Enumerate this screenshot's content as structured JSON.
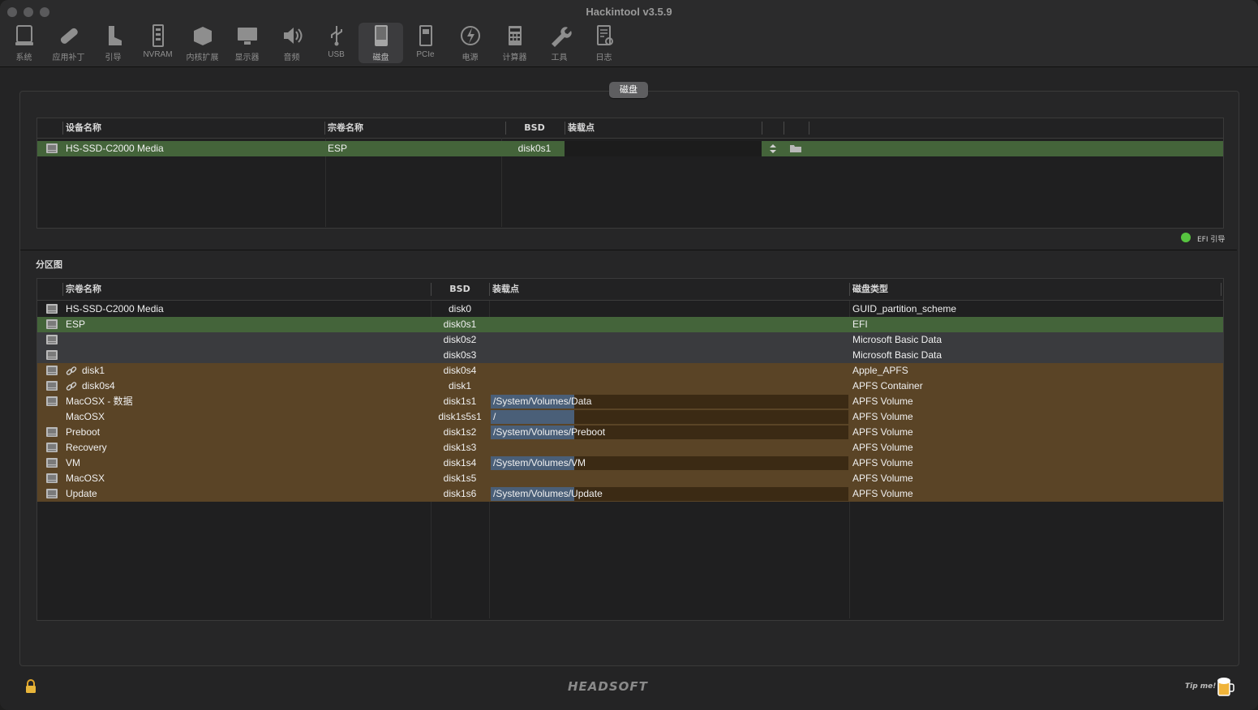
{
  "window": {
    "title": "Hackintool v3.5.9"
  },
  "toolbar": [
    {
      "label": "系统",
      "icon": "computer-icon"
    },
    {
      "label": "应用补丁",
      "icon": "bandage-icon"
    },
    {
      "label": "引导",
      "icon": "boot-icon"
    },
    {
      "label": "NVRAM",
      "icon": "nvram-icon"
    },
    {
      "label": "内核扩展",
      "icon": "kext-icon"
    },
    {
      "label": "显示器",
      "icon": "display-icon"
    },
    {
      "label": "音频",
      "icon": "speaker-icon"
    },
    {
      "label": "USB",
      "icon": "usb-icon"
    },
    {
      "label": "磁盘",
      "icon": "disk-icon",
      "active": true
    },
    {
      "label": "PCIe",
      "icon": "pcie-icon"
    },
    {
      "label": "电源",
      "icon": "power-icon"
    },
    {
      "label": "计算器",
      "icon": "calculator-icon"
    },
    {
      "label": "工具",
      "icon": "wrench-icon"
    },
    {
      "label": "日志",
      "icon": "log-icon"
    }
  ],
  "tab": {
    "label": "磁盘"
  },
  "top_table": {
    "headers": [
      "设备名称",
      "宗卷名称",
      "BSD",
      "装载点"
    ],
    "rows": [
      {
        "device": "HS-SSD-C2000 Media",
        "volume": "ESP",
        "bsd": "disk0s1",
        "mount": ""
      }
    ]
  },
  "legend": {
    "efi_label": "EFI 引导",
    "efi_color": "#57c440"
  },
  "partition": {
    "section_title": "分区图",
    "headers": [
      "宗卷名称",
      "BSD",
      "装载点",
      "磁盘类型"
    ],
    "rows": [
      {
        "name": "HS-SSD-C2000 Media",
        "bsd": "disk0",
        "mount_prefix": "",
        "mount_rest": "",
        "type": "GUID_partition_scheme",
        "style": "plain",
        "icon": true,
        "link": false
      },
      {
        "name": "ESP",
        "bsd": "disk0s1",
        "mount_prefix": "",
        "mount_rest": "",
        "type": "EFI",
        "style": "green",
        "icon": true,
        "link": false
      },
      {
        "name": "",
        "bsd": "disk0s2",
        "mount_prefix": "",
        "mount_rest": "",
        "type": "Microsoft Basic Data",
        "style": "gray",
        "icon": true,
        "link": false
      },
      {
        "name": "",
        "bsd": "disk0s3",
        "mount_prefix": "",
        "mount_rest": "",
        "type": "Microsoft Basic Data",
        "style": "gray",
        "icon": true,
        "link": false
      },
      {
        "name": "disk1",
        "bsd": "disk0s4",
        "mount_prefix": "",
        "mount_rest": "",
        "type": "Apple_APFS",
        "style": "brown",
        "icon": true,
        "link": true
      },
      {
        "name": "disk0s4",
        "bsd": "disk1",
        "mount_prefix": "",
        "mount_rest": "",
        "type": "APFS Container",
        "style": "brown",
        "icon": true,
        "link": true
      },
      {
        "name": "MacOSX - 数据",
        "bsd": "disk1s1",
        "mount_prefix": "/System/Volumes/",
        "mount_rest": "Data",
        "type": "APFS Volume",
        "style": "brown",
        "icon": true,
        "link": false
      },
      {
        "name": "MacOSX",
        "bsd": "disk1s5s1",
        "mount_prefix": "/",
        "mount_rest": "",
        "type": "APFS Volume",
        "style": "brown",
        "icon": false,
        "link": false
      },
      {
        "name": "Preboot",
        "bsd": "disk1s2",
        "mount_prefix": "/System/Volumes/",
        "mount_rest": "Preboot",
        "type": "APFS Volume",
        "style": "brown",
        "icon": true,
        "link": false
      },
      {
        "name": "Recovery",
        "bsd": "disk1s3",
        "mount_prefix": "",
        "mount_rest": "",
        "type": "APFS Volume",
        "style": "brown",
        "icon": true,
        "link": false
      },
      {
        "name": "VM",
        "bsd": "disk1s4",
        "mount_prefix": "/System/Volumes/",
        "mount_rest": "VM",
        "type": "APFS Volume",
        "style": "brown",
        "icon": true,
        "link": false
      },
      {
        "name": "MacOSX",
        "bsd": "disk1s5",
        "mount_prefix": "",
        "mount_rest": "",
        "type": "APFS Volume",
        "style": "brown",
        "icon": true,
        "link": false
      },
      {
        "name": "Update",
        "bsd": "disk1s6",
        "mount_prefix": "/System/Volumes/",
        "mount_rest": "Update",
        "type": "APFS Volume",
        "style": "brown",
        "icon": true,
        "link": false
      }
    ]
  },
  "footer": {
    "brand": "HEADSOFT",
    "tip": "Tip me!"
  },
  "colors": {
    "green_row": "#44643a",
    "gray_row": "#3a3b3e",
    "brown_row": "#5a4426",
    "mount_highlight": "#4a5f78"
  }
}
